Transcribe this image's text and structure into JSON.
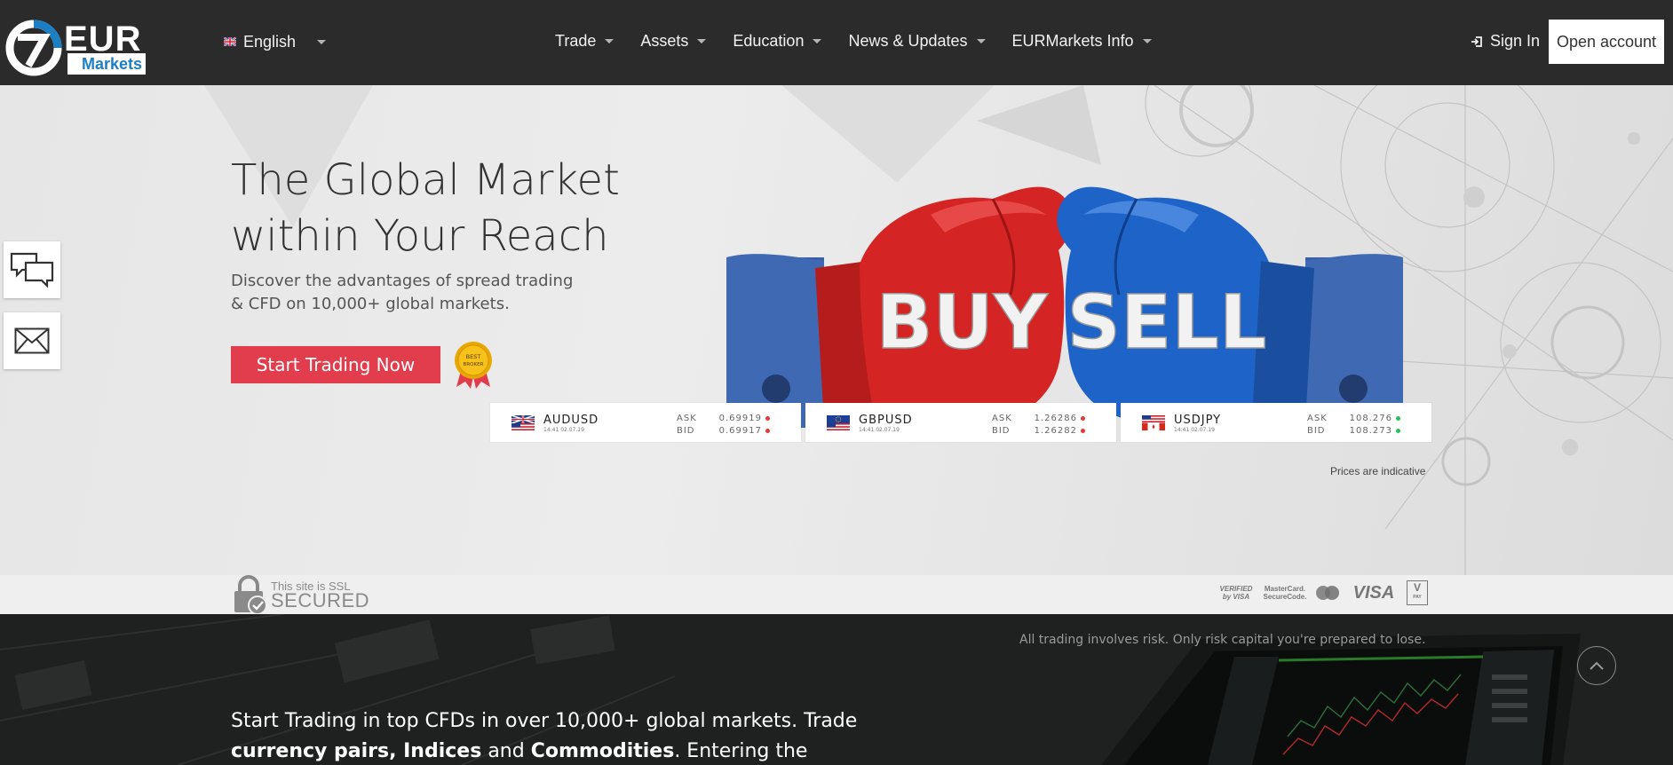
{
  "header": {
    "logo": {
      "word": "EUR",
      "sub": "Markets"
    },
    "language": {
      "label": "English"
    },
    "nav": [
      {
        "label": "Trade"
      },
      {
        "label": "Assets"
      },
      {
        "label": "Education"
      },
      {
        "label": "News & Updates"
      },
      {
        "label": "EURMarkets Info"
      }
    ],
    "sign_in": "Sign In",
    "open_account": "Open account"
  },
  "hero": {
    "title_line1": "The Global Market",
    "title_line2": "within Your Reach",
    "subtitle_line1": "Discover the advantages of spread trading",
    "subtitle_line2": "& CFD on 10,000+ global markets.",
    "cta": "Start Trading Now",
    "badge_line1": "BEST",
    "badge_line2": "BROKER",
    "image_text_left": "BUY",
    "image_text_right": "SELL"
  },
  "tickers": [
    {
      "pair": "AUDUSD",
      "time": "14:41 02.07.19",
      "ask_label": "ASK",
      "ask": "0.69919",
      "bid_label": "BID",
      "bid": "0.69917",
      "ask_dir": "down",
      "bid_dir": "down"
    },
    {
      "pair": "GBPUSD",
      "time": "14:41 02.07.19",
      "ask_label": "ASK",
      "ask": "1.26286",
      "bid_label": "BID",
      "bid": "1.26282",
      "ask_dir": "down",
      "bid_dir": "down"
    },
    {
      "pair": "USDJPY",
      "time": "14:41 02.07.19",
      "ask_label": "ASK",
      "ask": "108.276",
      "bid_label": "BID",
      "bid": "108.273",
      "ask_dir": "up",
      "bid_dir": "up"
    }
  ],
  "prices_note": "Prices are indicative",
  "ssl": {
    "line1": "This site is SSL",
    "line2": "SECURED"
  },
  "payments": [
    {
      "label_line1": "VERIFIED",
      "label_line2": "by VISA"
    },
    {
      "label_line1": "MasterCard.",
      "label_line2": "SecureCode."
    },
    {
      "label_line1": "",
      "label_line2": ""
    },
    {
      "label_line1": "VISA",
      "label_line2": ""
    },
    {
      "label_line1": "V",
      "label_line2": "PAY"
    }
  ],
  "risk_text": "All trading involves risk. Only risk capital you're prepared to lose.",
  "bottom": {
    "line1": "Start Trading in top CFDs in over 10,000+ global markets. Trade",
    "bold1": "currency pairs, Indices",
    "mid1": "and",
    "bold2": "Commodities",
    "tail": ". Entering the global"
  },
  "colors": {
    "header_bg": "#2b2b2b",
    "brand_blue": "#1d7fc3",
    "cta_red": "#e23d4d",
    "dark_bg": "#1f2121",
    "down_dot": "#e53935",
    "up_dot": "#21c45a"
  }
}
